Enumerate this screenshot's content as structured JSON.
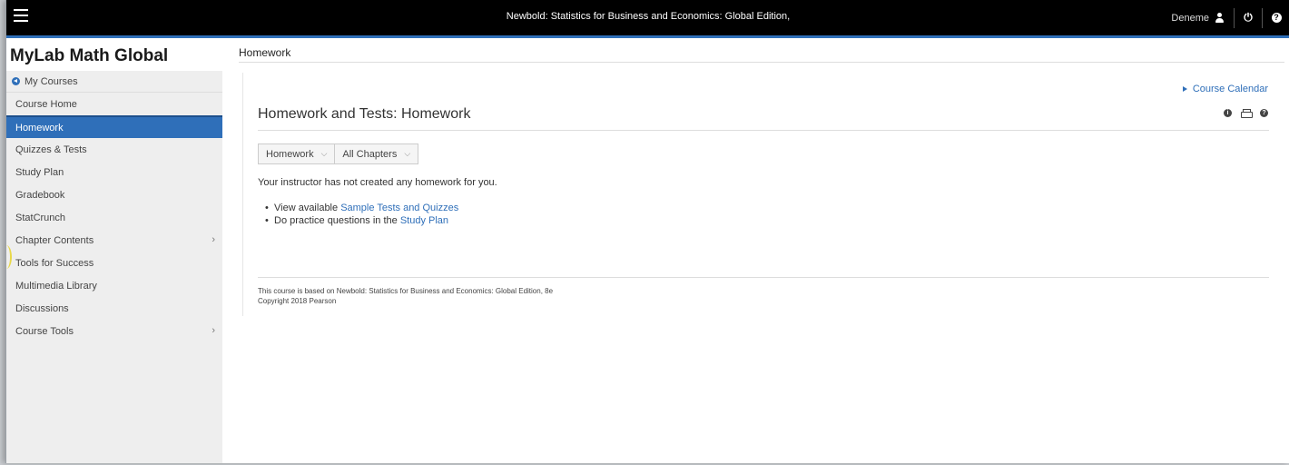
{
  "topbar": {
    "course_title": "Newbold: Statistics for Business and Economics: Global Edition,",
    "user_name": "Deneme",
    "help_glyph": "?",
    "power_glyph": "⏻"
  },
  "sidebar": {
    "brand": "MyLab Math Global",
    "my_courses": "My Courses",
    "items": [
      {
        "label": "Course Home"
      },
      {
        "label": "Homework",
        "active": true
      },
      {
        "label": "Quizzes & Tests"
      },
      {
        "label": "Study Plan"
      },
      {
        "label": "Gradebook"
      },
      {
        "label": "StatCrunch"
      },
      {
        "label": "Chapter Contents",
        "chevron": "›"
      },
      {
        "label": "Tools for Success"
      },
      {
        "label": "Multimedia Library"
      },
      {
        "label": "Discussions"
      },
      {
        "label": "Course Tools",
        "chevron": "›"
      }
    ]
  },
  "main": {
    "page_label": "Homework",
    "calendar_link": "Course Calendar",
    "section_title": "Homework and Tests: Homework",
    "info_glyph": "i",
    "help_glyph": "?",
    "filters": [
      {
        "label": "Homework",
        "caret": "⌵"
      },
      {
        "label": "All Chapters",
        "caret": "⌵"
      }
    ],
    "no_homework": "Your instructor has not created any homework for you.",
    "bullets": [
      {
        "prefix": "View available ",
        "link": "Sample Tests and Quizzes"
      },
      {
        "prefix": "Do practice questions in the ",
        "link": "Study Plan"
      }
    ],
    "footer_line1": "This course is based on Newbold: Statistics for Business and Economics: Global Edition, 8e",
    "footer_line2": "Copyright 2018 Pearson"
  },
  "colors": {
    "accent": "#2f6fb9",
    "topbar": "#000000",
    "sidebar": "#eeeeee"
  }
}
